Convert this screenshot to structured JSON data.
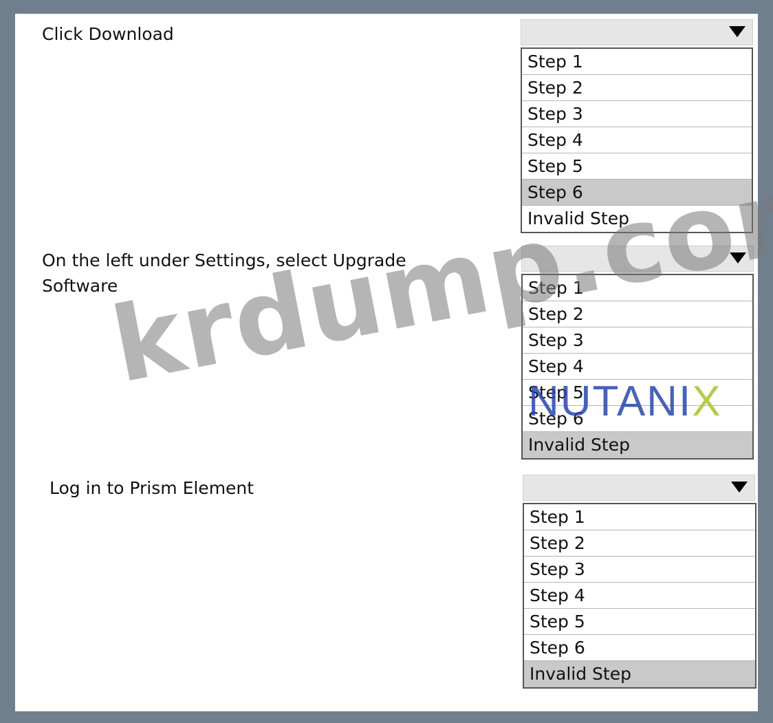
{
  "questions": [
    {
      "prompt": "Click Download",
      "options": [
        "Step 1",
        "Step 2",
        "Step 3",
        "Step 4",
        "Step 5",
        "Step 6",
        "Invalid Step"
      ],
      "selected": "Step 6"
    },
    {
      "prompt_line1": "On the left under Settings, select Upgrade",
      "prompt_line2": "Software",
      "options": [
        "Step 1",
        "Step 2",
        "Step 3",
        "Step 4",
        "Step 5",
        "Step 6",
        "Invalid Step"
      ],
      "selected": "Invalid Step"
    },
    {
      "prompt": "Log in to Prism Element",
      "options": [
        "Step 1",
        "Step 2",
        "Step 3",
        "Step 4",
        "Step 5",
        "Step 6",
        "Invalid Step"
      ],
      "selected": "Invalid Step"
    }
  ],
  "watermark": "krdump.com",
  "brand_logo": {
    "main": "NUTANI",
    "x": "X"
  },
  "colors": {
    "frame": "#6f7f8e",
    "selected_option": "#c9c9c9",
    "header": "#e6e6e6"
  },
  "icons": {
    "dropdown_arrow": "triangle-down-icon"
  }
}
